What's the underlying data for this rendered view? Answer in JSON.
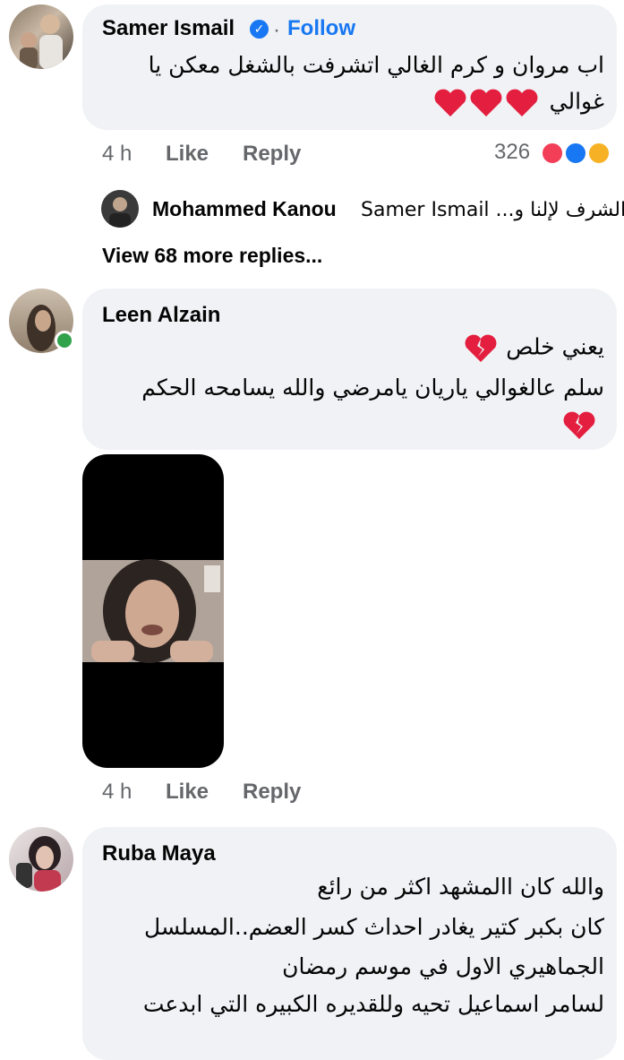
{
  "comments": [
    {
      "author": "Samer Ismail",
      "follow_label": "Follow",
      "dot": "·",
      "text_line1": "اب مروان و كرم الغالي اتشرفت بالشغل معكن يا",
      "text_line2": "غوالي",
      "time": "4 h",
      "like_label": "Like",
      "reply_label": "Reply",
      "reaction_count": "326",
      "reply_preview": {
        "author": "Mohammed Kanou",
        "text": "Samer Ismail ...الشرف لإلنا و"
      },
      "view_more_label": "View 68 more replies..."
    },
    {
      "author": "Leen Alzain",
      "text_line1": "يعني خلص",
      "text_line2": "سلم عالغوالي ياريان يامرضي والله يسامحه الحكم",
      "time": "4 h",
      "like_label": "Like",
      "reply_label": "Reply"
    },
    {
      "author": "Ruba Maya",
      "text_line1": "والله كان االمشهد اكثر من رائع",
      "text_line2": "كان بكبر كتير يغادر احداث كسر العضم..المسلسل",
      "text_line3": "الجماهيري الاول في موسم رمضان",
      "text_line4": "لسامر اسماعيل تحيه وللقديره الكبيره التي ابدعت"
    }
  ],
  "colors": {
    "bubble": "#f0f2f5",
    "link": "#1877f2",
    "meta": "#65676b",
    "heart": "#e41e3f",
    "online": "#31a24c"
  }
}
